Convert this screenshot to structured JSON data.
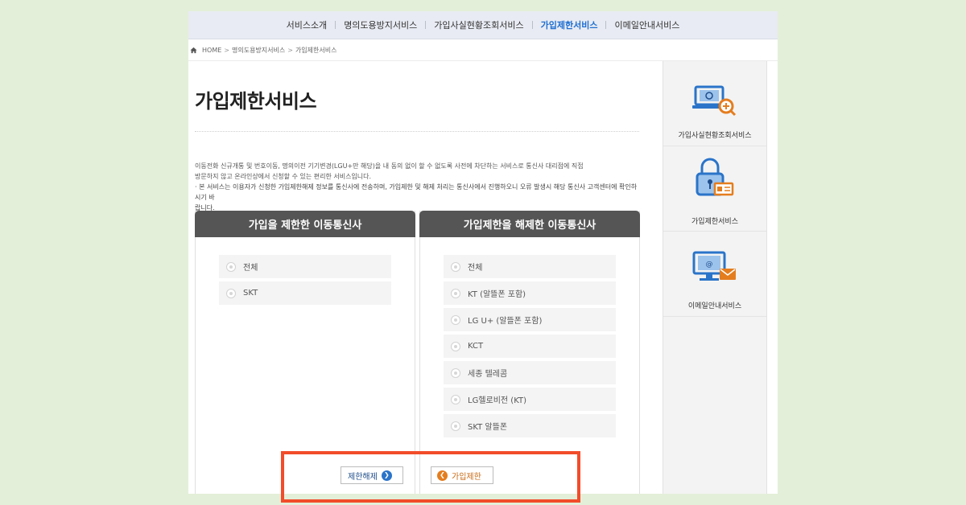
{
  "nav": {
    "items": [
      "서비스소개",
      "명의도용방지서비스",
      "가입사실현황조회서비스",
      "가입제한서비스",
      "이메일안내서비스"
    ],
    "active_index": 3,
    "active_color": "#1f6fd1"
  },
  "breadcrumb": [
    "HOME",
    "명의도용방지서비스",
    "가입제한서비스"
  ],
  "page": {
    "title": "가입제한서비스",
    "desc_line1": "이동전화 신규개통 및 번호이동, 명의이전 기기변경(LGU+만 해당)을 내 동의 없이 할 수 없도록 사전에 차단하는 서비스로 통신사 대리점에 직접",
    "desc_line2": "방문하지 않고 온라인상에서 신청할 수 있는 편리한 서비스입니다.",
    "note_line1": "· 본 서비스는 이용자가 신청한 가입제한해제 정보를 통신사에 전송하며, 가입제한 및 해제 처리는 통신사에서 진행하오니 오류 발생시 해당 통신사 고객센터에 확인하시기 바",
    "note_line2": "랍니다."
  },
  "panels": {
    "left": {
      "title": "가입을 제한한 이동통신사",
      "options": [
        "전체",
        "SKT"
      ]
    },
    "right": {
      "title": "가입제한을 해제한 이동통신사",
      "options": [
        "전체",
        "KT (알뜰폰 포함)",
        "LG U+ (알뜰폰 포함)",
        "KCT",
        "세종 텔레콤",
        "LG헬로비전 (KT)",
        "SKT 알뜰폰"
      ]
    }
  },
  "buttons": {
    "release_label": "제한해제",
    "restrict_label": "가입제한"
  },
  "sidebar": {
    "items": [
      "가입사실현황조회서비스",
      "가입제한서비스",
      "이메일안내서비스"
    ]
  },
  "colors": {
    "highlight": "#f24c2a",
    "icon_blue": "#2a74c9",
    "icon_orange": "#e47d1e",
    "background": "#e4efd9"
  }
}
